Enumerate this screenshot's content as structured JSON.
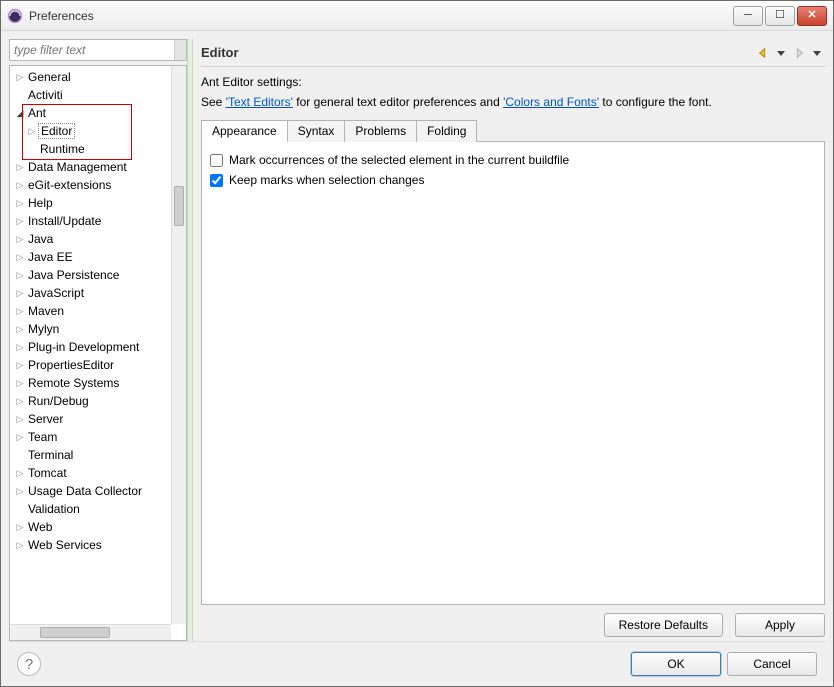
{
  "window": {
    "title": "Preferences"
  },
  "sidebar": {
    "filter_placeholder": "type filter text",
    "items": [
      {
        "label": "General",
        "depth": 0,
        "expandable": true,
        "open": false
      },
      {
        "label": "Activiti",
        "depth": 0,
        "expandable": false
      },
      {
        "label": "Ant",
        "depth": 0,
        "expandable": true,
        "open": true
      },
      {
        "label": "Editor",
        "depth": 1,
        "expandable": true,
        "open": false,
        "selected": true
      },
      {
        "label": "Runtime",
        "depth": 1,
        "expandable": false
      },
      {
        "label": "Data Management",
        "depth": 0,
        "expandable": true,
        "open": false
      },
      {
        "label": "eGit-extensions",
        "depth": 0,
        "expandable": true,
        "open": false
      },
      {
        "label": "Help",
        "depth": 0,
        "expandable": true,
        "open": false
      },
      {
        "label": "Install/Update",
        "depth": 0,
        "expandable": true,
        "open": false
      },
      {
        "label": "Java",
        "depth": 0,
        "expandable": true,
        "open": false
      },
      {
        "label": "Java EE",
        "depth": 0,
        "expandable": true,
        "open": false
      },
      {
        "label": "Java Persistence",
        "depth": 0,
        "expandable": true,
        "open": false
      },
      {
        "label": "JavaScript",
        "depth": 0,
        "expandable": true,
        "open": false
      },
      {
        "label": "Maven",
        "depth": 0,
        "expandable": true,
        "open": false
      },
      {
        "label": "Mylyn",
        "depth": 0,
        "expandable": true,
        "open": false
      },
      {
        "label": "Plug-in Development",
        "depth": 0,
        "expandable": true,
        "open": false
      },
      {
        "label": "PropertiesEditor",
        "depth": 0,
        "expandable": true,
        "open": false
      },
      {
        "label": "Remote Systems",
        "depth": 0,
        "expandable": true,
        "open": false
      },
      {
        "label": "Run/Debug",
        "depth": 0,
        "expandable": true,
        "open": false
      },
      {
        "label": "Server",
        "depth": 0,
        "expandable": true,
        "open": false
      },
      {
        "label": "Team",
        "depth": 0,
        "expandable": true,
        "open": false
      },
      {
        "label": "Terminal",
        "depth": 0,
        "expandable": false
      },
      {
        "label": "Tomcat",
        "depth": 0,
        "expandable": true,
        "open": false
      },
      {
        "label": "Usage Data Collector",
        "depth": 0,
        "expandable": true,
        "open": false
      },
      {
        "label": "Validation",
        "depth": 0,
        "expandable": false
      },
      {
        "label": "Web",
        "depth": 0,
        "expandable": true,
        "open": false
      },
      {
        "label": "Web Services",
        "depth": 0,
        "expandable": true,
        "open": false
      }
    ]
  },
  "content": {
    "title": "Editor",
    "desc_line1": "Ant Editor settings:",
    "desc_prefix": "See ",
    "link1": "'Text Editors'",
    "desc_mid": " for general text editor preferences and ",
    "link2": "'Colors and Fonts'",
    "desc_suffix": " to configure the font.",
    "tabs": [
      "Appearance",
      "Syntax",
      "Problems",
      "Folding"
    ],
    "active_tab": 0,
    "checkboxes": [
      {
        "label": "Mark occurrences of the selected element in the current buildfile",
        "checked": false
      },
      {
        "label": "Keep marks when selection changes",
        "checked": true
      }
    ],
    "buttons": {
      "restore": "Restore Defaults",
      "apply": "Apply"
    }
  },
  "footer": {
    "ok": "OK",
    "cancel": "Cancel"
  }
}
